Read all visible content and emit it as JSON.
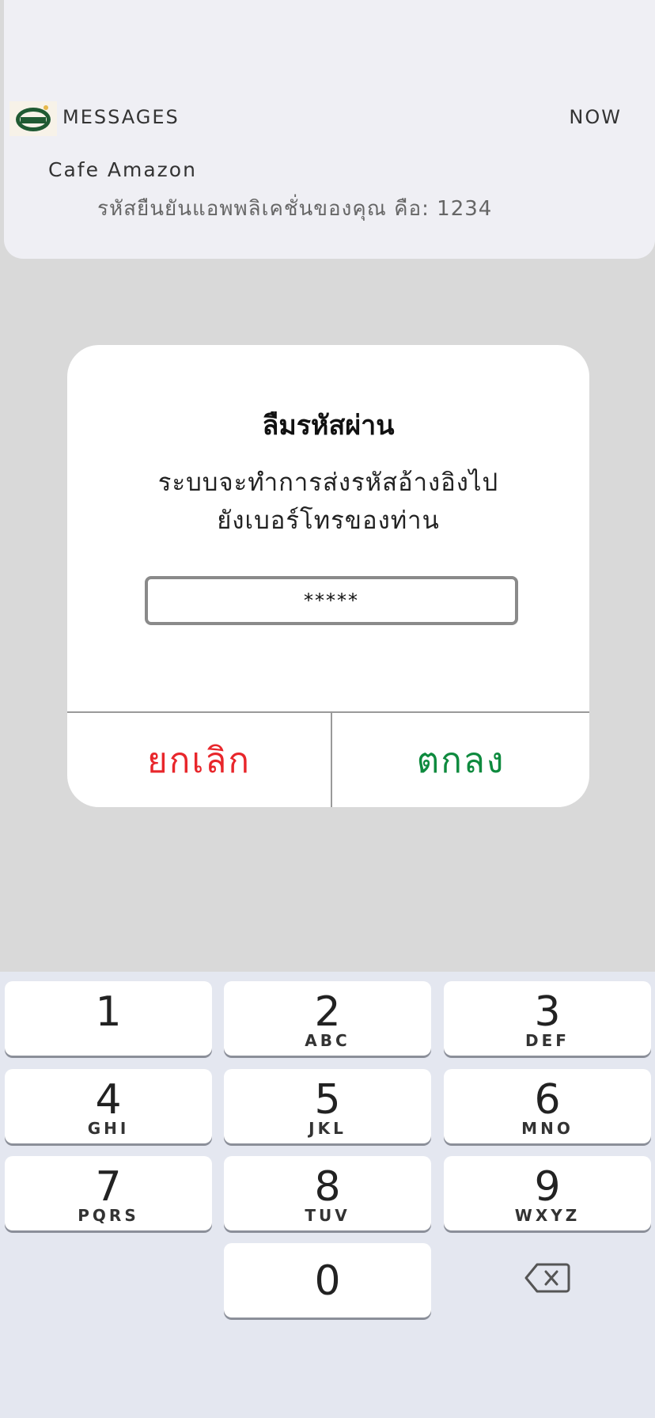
{
  "notification": {
    "app_label": "MESSAGES",
    "time": "NOW",
    "sender": "Cafe Amazon",
    "body": "รหัสยืนยันแอพพลิเคชั่นของคุณ คือ: 1234",
    "logo_text": "Amazon"
  },
  "dialog": {
    "title": "ลืมรหัสผ่าน",
    "message_line1": "ระบบจะทำการส่งรหัสอ้างอิงไป",
    "message_line2": "ยังเบอร์โทรของท่าน",
    "input_value": "*****",
    "cancel_label": "ยกเลิก",
    "ok_label": "ตกลง",
    "cancel_color": "#e8262b",
    "ok_color": "#0e8a3e"
  },
  "keypad": {
    "keys": [
      {
        "num": "1",
        "letters": ""
      },
      {
        "num": "2",
        "letters": "ABC"
      },
      {
        "num": "3",
        "letters": "DEF"
      },
      {
        "num": "4",
        "letters": "GHI"
      },
      {
        "num": "5",
        "letters": "JKL"
      },
      {
        "num": "6",
        "letters": "MNO"
      },
      {
        "num": "7",
        "letters": "PQRS"
      },
      {
        "num": "8",
        "letters": "TUV"
      },
      {
        "num": "9",
        "letters": "WXYZ"
      },
      {
        "num": "0",
        "letters": ""
      }
    ],
    "backspace_icon": "backspace-icon"
  }
}
